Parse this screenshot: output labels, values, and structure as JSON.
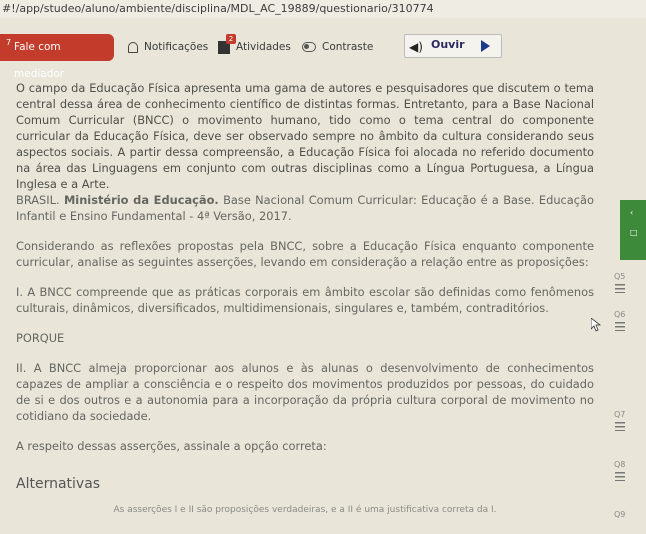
{
  "browser": {
    "url": "#!/app/studeo/aluno/ambiente/disciplina/MDL_AC_19889/questionario/310774"
  },
  "toolbar": {
    "mediador_label": "Fale com mediador",
    "mediador_badge": "7",
    "notificacoes_label": "Notificações",
    "atividades_label": "Atividades",
    "atividades_badge": "2",
    "contraste_label": "Contraste",
    "ouvir_label": "Ouvir",
    "accent_color": "#c23b2b"
  },
  "question": {
    "intro": "O campo da Educação Física apresenta uma gama de autores e pesquisadores que discutem o tema central dessa área de conhecimento científico de distintas formas. Entretanto, para a Base Nacional Comum Curricular (BNCC) o movimento humano, tido como o tema central do componente curricular da Educação Física, deve ser observado sempre no âmbito da cultura considerando seus aspectos sociais. A partir dessa compreensão, a Educação Física foi alocada no referido documento na área das Linguagens em conjunto com outras disciplinas como a Língua Portuguesa, a Língua Inglesa e a Arte.",
    "reference_prefix": "BRASIL. ",
    "reference_bold": "Ministério da Educação.",
    "reference_rest": " Base Nacional Comum Curricular: Educação é a Base. Educação Infantil e Ensino Fundamental - 4ª Versão, 2017.",
    "considerando": "Considerando as reflexões propostas pela BNCC, sobre a Educação Física enquanto componente curricular, analise as seguintes asserções, levando em consideração a relação entre as proposições:",
    "assertion_1": "I. A BNCC compreende que as práticas corporais em âmbito escolar são definidas como fenômenos culturais, dinâmicos, diversificados, multidimensionais, singulares e, também, contraditórios.",
    "porque": "PORQUE",
    "assertion_2": "II. A BNCC almeja proporcionar aos alunos e às alunas o desenvolvimento de conhecimentos capazes de ampliar a consciência e o respeito dos movimentos produzidos por pessoas, do cuidado de si e dos outros e a autonomia para a incorporação da própria cultura corporal de movimento no cotidiano da sociedade.",
    "instruction": "A respeito dessas asserções, assinale a opção correta:"
  },
  "alternatives": {
    "title": "Alternativas",
    "first_option": "As asserções I e II são proposições verdadeiras, e a II é uma justificativa correta da I."
  },
  "side_nav": {
    "items": [
      "Q5",
      "Q6",
      "Q7",
      "Q8",
      "Q9"
    ]
  }
}
